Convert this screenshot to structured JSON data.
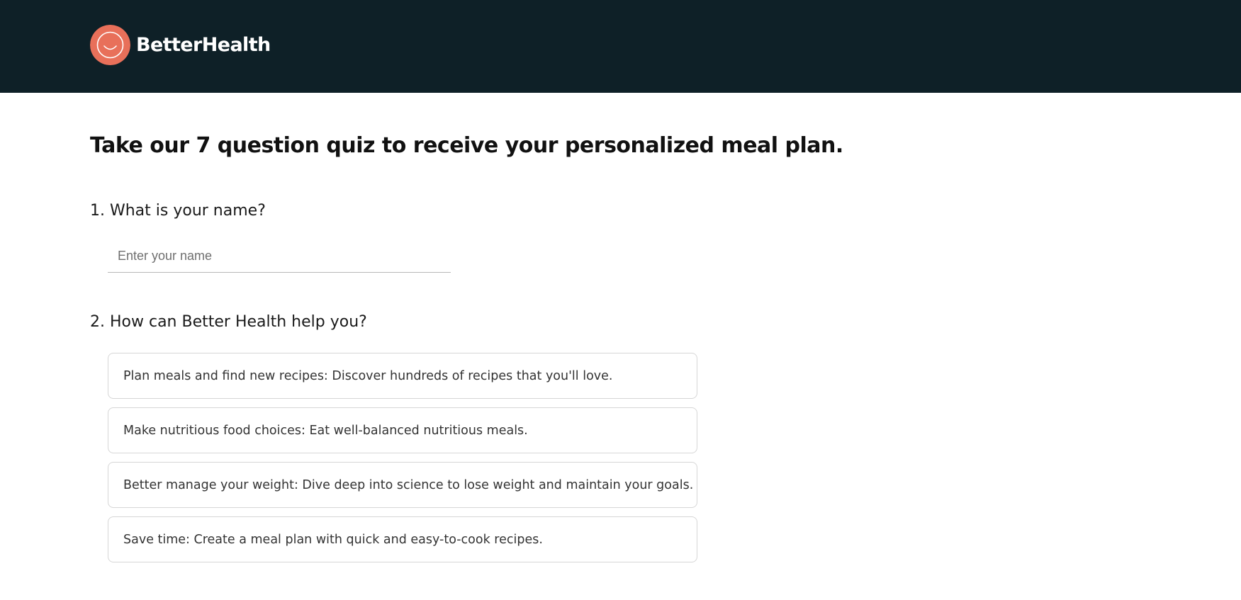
{
  "header": {
    "brand_name": "BetterHealth",
    "logo_icon": "smile-icon",
    "logo_color": "#e8705a",
    "background_color": "#0e2027"
  },
  "quiz": {
    "title": "Take our 7 question quiz to receive your personalized meal plan.",
    "question_1": {
      "label": "1. What is your name?",
      "input_value": "",
      "input_placeholder": "Enter your name"
    },
    "question_2": {
      "label": "2. How can Better Health help you?",
      "options": [
        {
          "label": "Plan meals and find new recipes: Discover hundreds of recipes that you'll love."
        },
        {
          "label": "Make nutritious food choices: Eat well-balanced nutritious meals."
        },
        {
          "label": "Better manage your weight: Dive deep into science to lose weight and maintain your goals."
        },
        {
          "label": "Save time: Create a meal plan with quick and easy-to-cook recipes."
        }
      ]
    }
  }
}
